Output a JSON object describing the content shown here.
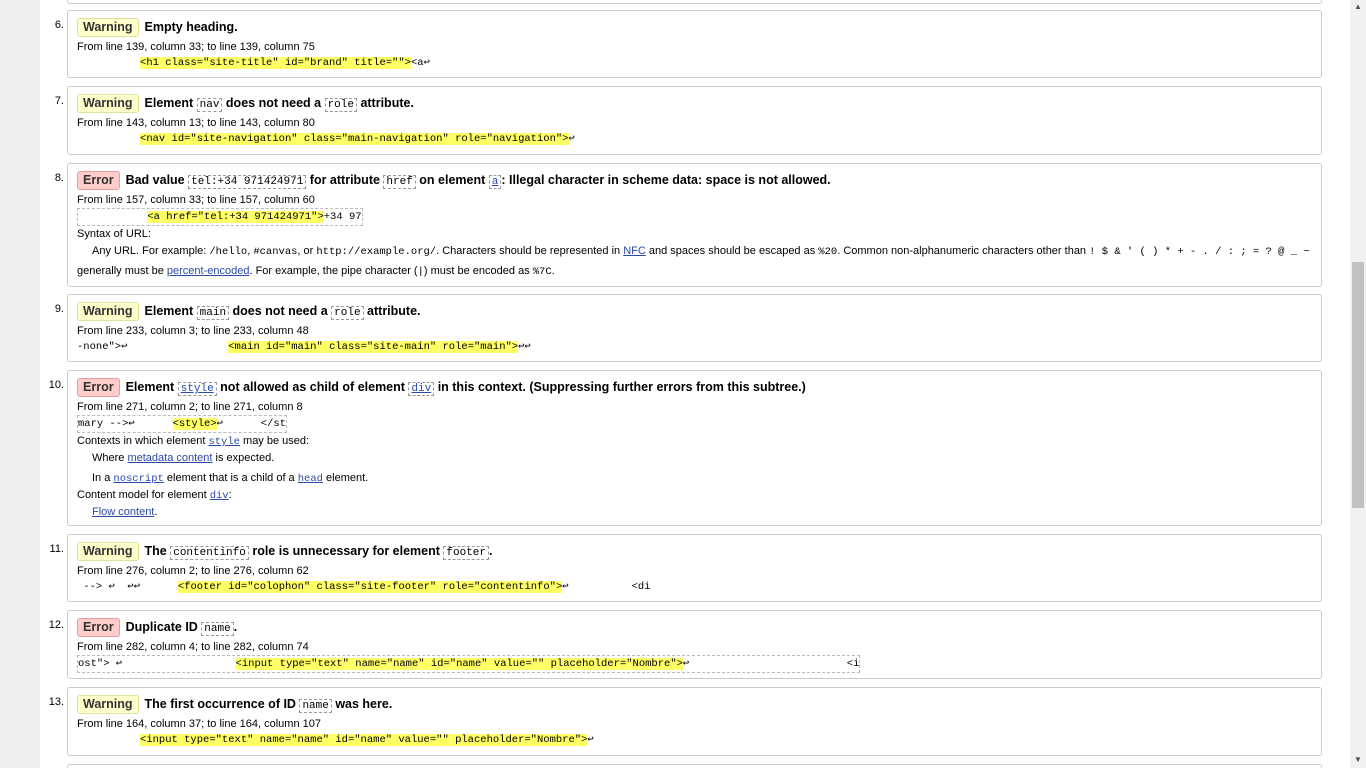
{
  "messages": [
    {
      "num": "6.",
      "type": "Warning",
      "title_parts": [
        {
          "t": "text",
          "v": "Empty heading."
        }
      ],
      "location": "From line 139, column 33; to line 139, column 75",
      "extract_pre": "          ",
      "extract_hl": "<h1 class=\"site-title\" id=\"brand\" title=\"\">",
      "extract_post": "<a↩"
    },
    {
      "num": "7.",
      "type": "Warning",
      "title_parts": [
        {
          "t": "text",
          "v": "Element "
        },
        {
          "t": "code",
          "v": "nav"
        },
        {
          "t": "text",
          "v": " does not need a "
        },
        {
          "t": "code",
          "v": "role"
        },
        {
          "t": "text",
          "v": " attribute."
        }
      ],
      "location": "From line 143, column 13; to line 143, column 80",
      "extract_pre": "          ",
      "extract_hl": "<nav id=\"site-navigation\" class=\"main-navigation\" role=\"navigation\">",
      "extract_post": "↩"
    },
    {
      "num": "8.",
      "type": "Error",
      "title_parts": [
        {
          "t": "text",
          "v": "Bad value "
        },
        {
          "t": "code",
          "v": "tel:+34 971424971"
        },
        {
          "t": "text",
          "v": " for attribute "
        },
        {
          "t": "code",
          "v": "href"
        },
        {
          "t": "text",
          "v": " on element "
        },
        {
          "t": "codelink",
          "v": "a"
        },
        {
          "t": "text",
          "v": ": Illegal character in scheme data: space is not allowed."
        }
      ],
      "location": "From line 157, column 33; to line 157, column 60",
      "extract_pre": "           ",
      "extract_hl": "<a href=\"tel:+34 971424971\">",
      "extract_post": "+34 97",
      "syntax_label": "Syntax of URL:",
      "syntax_line1_a": "Any URL. For example: ",
      "syntax_code1": "/hello",
      "syntax_line1_b": ", ",
      "syntax_code2": "#canvas",
      "syntax_line1_c": ", or ",
      "syntax_code3": "http://example.org/",
      "syntax_line1_d": ". Characters should be represented in ",
      "syntax_link1": "NFC",
      "syntax_line1_e": " and spaces should be escaped as ",
      "syntax_code4": "%20",
      "syntax_line1_f": ". Common non-alphanumeric characters other than ",
      "syntax_code5": "! $ & ' ( ) * + - . / : ; = ? @ _ ~",
      "syntax_line2_a": "generally must be ",
      "syntax_link2": "percent-encoded",
      "syntax_line2_b": ". For example, the pipe character (",
      "syntax_code6": "|",
      "syntax_line2_c": ") must be encoded as ",
      "syntax_code7": "%7C",
      "syntax_line2_d": "."
    },
    {
      "num": "9.",
      "type": "Warning",
      "title_parts": [
        {
          "t": "text",
          "v": "Element "
        },
        {
          "t": "code",
          "v": "main"
        },
        {
          "t": "text",
          "v": " does not need a "
        },
        {
          "t": "code",
          "v": "role"
        },
        {
          "t": "text",
          "v": " attribute."
        }
      ],
      "location": "From line 233, column 3; to line 233, column 48",
      "extract_pre": "-none\">↩                ",
      "extract_hl": "<main id=\"main\" class=\"site-main\" role=\"main\">",
      "extract_post": "↩↩"
    },
    {
      "num": "10.",
      "type": "Error",
      "title_parts": [
        {
          "t": "text",
          "v": "Element "
        },
        {
          "t": "codelink",
          "v": "style"
        },
        {
          "t": "text",
          "v": " not allowed as child of element "
        },
        {
          "t": "codelink",
          "v": "div"
        },
        {
          "t": "text",
          "v": " in this context. (Suppressing further errors from this subtree.)"
        }
      ],
      "location": "From line 271, column 2; to line 271, column 8",
      "extract_pre": "mary -->↩      ",
      "extract_hl": "<style>",
      "extract_post": "↩      </st",
      "ctx_label_a": "Contexts in which element ",
      "ctx_label_code": "style",
      "ctx_label_b": " may be used:",
      "ctx1_a": "Where ",
      "ctx1_link": "metadata content",
      "ctx1_b": " is expected.",
      "ctx2_a": "In a ",
      "ctx2_link1": "noscript",
      "ctx2_b": " element that is a child of a ",
      "ctx2_link2": "head",
      "ctx2_c": " element.",
      "cm_label_a": "Content model for element ",
      "cm_label_code": "div",
      "cm_label_b": ":",
      "cm_link": "Flow content",
      "cm_after": "."
    },
    {
      "num": "11.",
      "type": "Warning",
      "title_parts": [
        {
          "t": "text",
          "v": "The "
        },
        {
          "t": "code",
          "v": "contentinfo"
        },
        {
          "t": "text",
          "v": " role is unnecessary for element "
        },
        {
          "t": "code",
          "v": "footer"
        },
        {
          "t": "text",
          "v": "."
        }
      ],
      "location": "From line 276, column 2; to line 276, column 62",
      "extract_pre": " --> ↩  ↩↩      ",
      "extract_hl": "<footer id=\"colophon\" class=\"site-footer\" role=\"contentinfo\">",
      "extract_post": "↩          <di"
    },
    {
      "num": "12.",
      "type": "Error",
      "title_parts": [
        {
          "t": "text",
          "v": "Duplicate ID "
        },
        {
          "t": "code",
          "v": "name"
        },
        {
          "t": "text",
          "v": "."
        }
      ],
      "location": "From line 282, column 4; to line 282, column 74",
      "extract_pre": "ost\"> ↩                  ",
      "extract_hl": "<input type=\"text\" name=\"name\" id=\"name\" value=\"\" placeholder=\"Nombre\">",
      "extract_post": "↩                         <i"
    },
    {
      "num": "13.",
      "type": "Warning",
      "title_parts": [
        {
          "t": "text",
          "v": "The first occurrence of ID "
        },
        {
          "t": "code",
          "v": "name"
        },
        {
          "t": "text",
          "v": " was here."
        }
      ],
      "location": "From line 164, column 37; to line 164, column 107",
      "extract_pre": "          ",
      "extract_hl": "<input type=\"text\" name=\"name\" id=\"name\" value=\"\" placeholder=\"Nombre\">",
      "extract_post": "↩"
    }
  ]
}
